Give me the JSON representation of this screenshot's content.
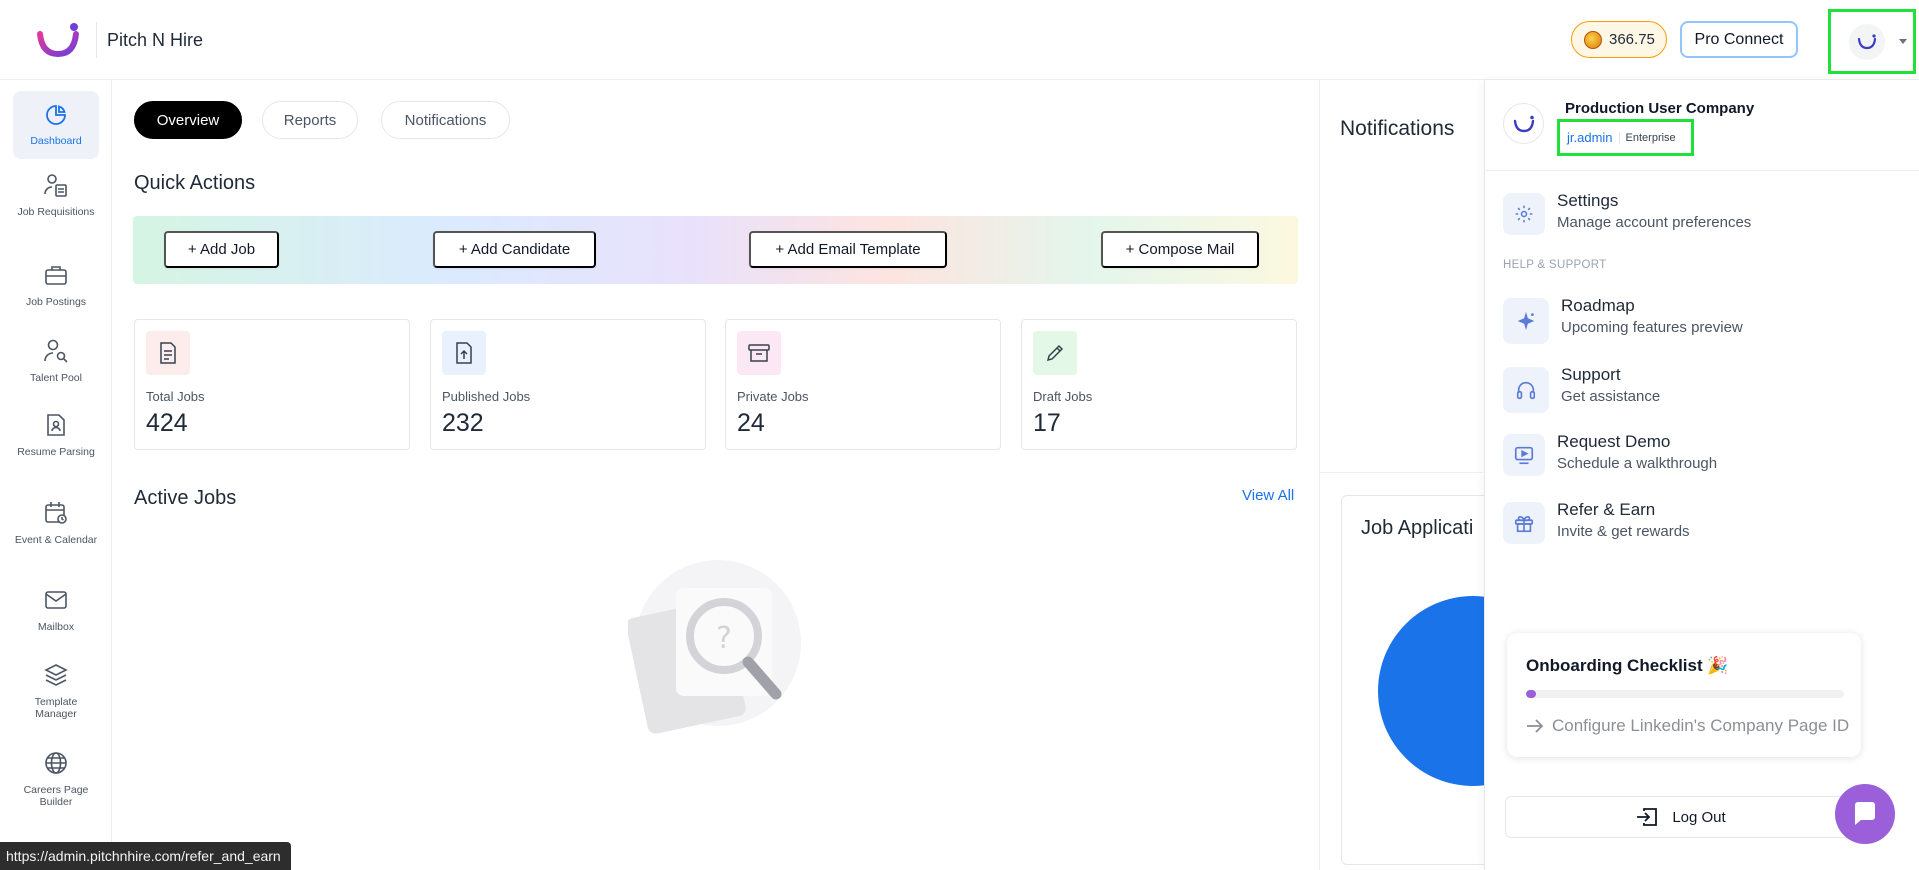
{
  "header": {
    "brand": "Pitch N Hire",
    "credits": "366.75",
    "pro_connect_label": "Pro Connect",
    "icons": {
      "logo": "brand-logo-icon",
      "coin": "coin-icon",
      "avatar": "company-avatar-icon",
      "caret": "caret-down-icon"
    }
  },
  "sidebar": {
    "items": [
      {
        "label": "Dashboard",
        "icon": "pie-chart-icon",
        "active": true
      },
      {
        "label": "Job Requisitions",
        "icon": "user-document-icon"
      },
      {
        "label": "Job Postings",
        "icon": "briefcase-icon"
      },
      {
        "label": "Talent Pool",
        "icon": "user-search-icon"
      },
      {
        "label": "Resume Parsing",
        "icon": "resume-icon"
      },
      {
        "label": "Event & Calendar",
        "icon": "calendar-icon"
      },
      {
        "label": "Mailbox",
        "icon": "mail-icon"
      },
      {
        "label": "Template Manager",
        "icon": "layers-icon"
      },
      {
        "label": "Careers Page Builder",
        "icon": "globe-icon"
      }
    ]
  },
  "tabs": [
    {
      "label": "Overview",
      "active": true
    },
    {
      "label": "Reports"
    },
    {
      "label": "Notifications"
    }
  ],
  "quick_actions": {
    "title": "Quick Actions",
    "buttons": [
      "+ Add Job",
      "+ Add Candidate",
      "+ Add Email Template",
      "+ Compose Mail"
    ]
  },
  "stats": [
    {
      "label": "Total Jobs",
      "value": "424",
      "icon": "document-icon",
      "color": "#fdecec"
    },
    {
      "label": "Published Jobs",
      "value": "232",
      "icon": "file-upload-icon",
      "color": "#e8f1fd"
    },
    {
      "label": "Private Jobs",
      "value": "24",
      "icon": "archive-icon",
      "color": "#fce8f4"
    },
    {
      "label": "Draft Jobs",
      "value": "17",
      "icon": "pencil-icon",
      "color": "#e4f8e8"
    }
  ],
  "active_jobs": {
    "title": "Active Jobs",
    "view_all": "View All",
    "empty_icon": "magnifier-empty-state-icon"
  },
  "right_pane": {
    "notifications_title": "Notifications",
    "job_applications_title": "Job Applicati"
  },
  "dropdown": {
    "company": "Production User Company",
    "username": "jr.admin",
    "plan": "Enterprise",
    "settings": {
      "title": "Settings",
      "subtitle": "Manage account preferences",
      "icon": "gear-icon"
    },
    "help_label": "HELP & SUPPORT",
    "help_items": [
      {
        "title": "Roadmap",
        "subtitle": "Upcoming features preview",
        "icon": "sparkle-icon"
      },
      {
        "title": "Support",
        "subtitle": "Get assistance",
        "icon": "headphones-icon"
      },
      {
        "title": "Request Demo",
        "subtitle": "Schedule a walkthrough",
        "icon": "video-play-icon"
      },
      {
        "title": "Refer & Earn",
        "subtitle": "Invite & get rewards",
        "icon": "gift-icon"
      }
    ],
    "logout_label": "Log Out"
  },
  "checklist": {
    "title": "Onboarding Checklist 🎉",
    "progress_percent": 3,
    "step": "Configure Linkedin's Company Page ID"
  },
  "status_bar": {
    "url": "https://admin.pitchnhire.com/refer_and_earn"
  },
  "colors": {
    "accent": "#1a73e8",
    "purple": "#9a5fd9",
    "highlight": "#22e03a"
  }
}
